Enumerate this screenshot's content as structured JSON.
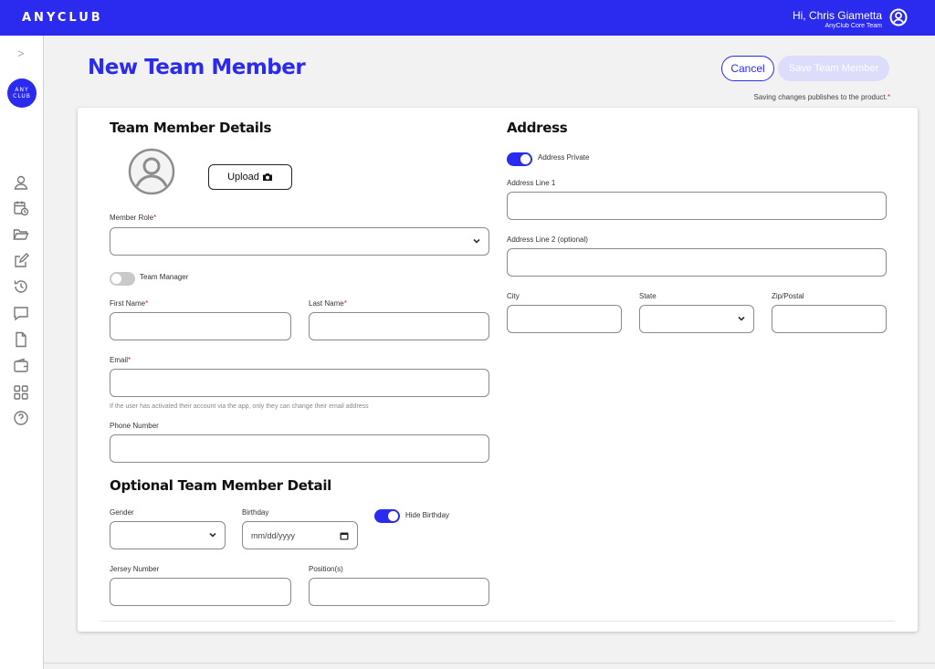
{
  "app": {
    "brand": "ANYCLUB",
    "user_greeting": "Hi, Chris Giametta",
    "user_team": "AnyClub Core Team",
    "club_logo_line1": "ANY",
    "club_logo_line2": "CLUB",
    "accent_color": "#2b2bf0"
  },
  "sidebar": {
    "collapse_glyph": ">",
    "icons": [
      "user-icon",
      "calendar-clock-icon",
      "folder-icon",
      "edit-icon",
      "history-icon",
      "chat-icon",
      "document-icon",
      "wallet-icon",
      "grid-icon",
      "help-icon"
    ]
  },
  "header": {
    "title": "New Team Member",
    "cancel_label": "Cancel",
    "save_label": "Save Team Member",
    "save_note": "Saving changes publishes to the product.",
    "required_mark": "*"
  },
  "details": {
    "title": "Team Member Details",
    "upload_label": "Upload",
    "member_role_label": "Member Role",
    "member_role_value": "",
    "team_manager_label": "Team Manager",
    "team_manager_on": false,
    "first_name_label": "First Name",
    "first_name_value": "",
    "last_name_label": "Last Name",
    "last_name_value": "",
    "email_label": "Email",
    "email_value": "",
    "email_help": "If the user has activated their account via the app, only they can change their email address",
    "phone_label": "Phone Number",
    "phone_value": ""
  },
  "optional": {
    "title": "Optional Team Member Detail",
    "gender_label": "Gender",
    "gender_value": "",
    "birthday_label": "Birthday",
    "birthday_placeholder": "mm/dd/yyyy",
    "hide_birthday_label": "Hide Birthday",
    "hide_birthday_on": true,
    "jersey_label": "Jersey Number",
    "jersey_value": "",
    "positions_label": "Position(s)",
    "positions_value": ""
  },
  "address": {
    "title": "Address",
    "private_label": "Address Private",
    "private_on": true,
    "line1_label": "Address Line 1",
    "line1_value": "",
    "line2_label": "Address Line 2 (optional)",
    "line2_value": "",
    "city_label": "City",
    "city_value": "",
    "state_label": "State",
    "state_value": "",
    "zip_label": "Zip/Postal",
    "zip_value": ""
  }
}
